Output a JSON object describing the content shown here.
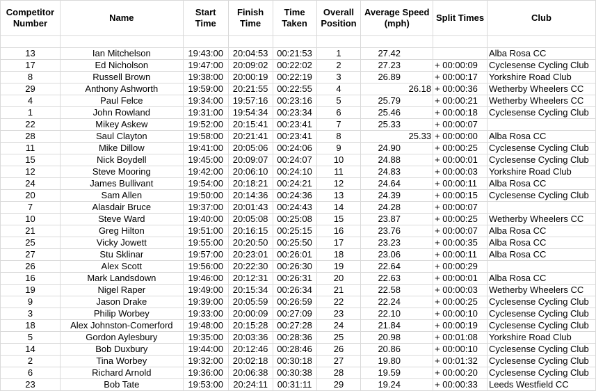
{
  "columns": [
    {
      "key": "number",
      "label": "Competitor Number"
    },
    {
      "key": "name",
      "label": "Name"
    },
    {
      "key": "start",
      "label": "Start Time"
    },
    {
      "key": "finish",
      "label": "Finish Time"
    },
    {
      "key": "taken",
      "label": "Time Taken"
    },
    {
      "key": "position",
      "label": "Overall Position"
    },
    {
      "key": "speed",
      "label": "Average Speed (mph)"
    },
    {
      "key": "split",
      "label": "Split Times"
    },
    {
      "key": "club",
      "label": "Club"
    }
  ],
  "rows": [
    {
      "number": "13",
      "name": "Ian Mitchelson",
      "start": "19:43:00",
      "finish": "20:04:53",
      "taken": "00:21:53",
      "position": "1",
      "speed": "27.42",
      "split": "",
      "club": "Alba Rosa CC",
      "speed_align": "center"
    },
    {
      "number": "17",
      "name": "Ed Nicholson",
      "start": "19:47:00",
      "finish": "20:09:02",
      "taken": "00:22:02",
      "position": "2",
      "speed": "27.23",
      "split": "+ 00:00:09",
      "club": "Cyclesense Cycling Club",
      "speed_align": "center"
    },
    {
      "number": "8",
      "name": "Russell Brown",
      "start": "19:38:00",
      "finish": "20:00:19",
      "taken": "00:22:19",
      "position": "3",
      "speed": "26.89",
      "split": "+ 00:00:17",
      "club": "Yorkshire Road Club",
      "speed_align": "center"
    },
    {
      "number": "29",
      "name": "Anthony Ashworth",
      "start": "19:59:00",
      "finish": "20:21:55",
      "taken": "00:22:55",
      "position": "4",
      "speed": "26.18",
      "split": "+ 00:00:36",
      "club": "Wetherby Wheelers CC",
      "speed_align": "right"
    },
    {
      "number": "4",
      "name": "Paul Felce",
      "start": "19:34:00",
      "finish": "19:57:16",
      "taken": "00:23:16",
      "position": "5",
      "speed": "25.79",
      "split": "+ 00:00:21",
      "club": "Wetherby Wheelers CC",
      "speed_align": "center"
    },
    {
      "number": "1",
      "name": "John Rowland",
      "start": "19:31:00",
      "finish": "19:54:34",
      "taken": "00:23:34",
      "position": "6",
      "speed": "25.46",
      "split": "+ 00:00:18",
      "club": "Cyclesense Cycling Club",
      "speed_align": "center"
    },
    {
      "number": "22",
      "name": "Mikey Askew",
      "start": "19:52:00",
      "finish": "20:15:41",
      "taken": "00:23:41",
      "position": "7",
      "speed": "25.33",
      "split": "+ 00:00:07",
      "club": "",
      "speed_align": "center"
    },
    {
      "number": "28",
      "name": "Saul Clayton",
      "start": "19:58:00",
      "finish": "20:21:41",
      "taken": "00:23:41",
      "position": "8",
      "speed": "25.33",
      "split": "+ 00:00:00",
      "club": "Alba Rosa CC",
      "speed_align": "right"
    },
    {
      "number": "11",
      "name": "Mike Dillow",
      "start": "19:41:00",
      "finish": "20:05:06",
      "taken": "00:24:06",
      "position": "9",
      "speed": "24.90",
      "split": "+ 00:00:25",
      "club": "Cyclesense Cycling Club",
      "speed_align": "center"
    },
    {
      "number": "15",
      "name": "Nick Boydell",
      "start": "19:45:00",
      "finish": "20:09:07",
      "taken": "00:24:07",
      "position": "10",
      "speed": "24.88",
      "split": "+ 00:00:01",
      "club": "Cyclesense Cycling Club",
      "speed_align": "center"
    },
    {
      "number": "12",
      "name": "Steve Mooring",
      "start": "19:42:00",
      "finish": "20:06:10",
      "taken": "00:24:10",
      "position": "11",
      "speed": "24.83",
      "split": "+ 00:00:03",
      "club": "Yorkshire Road Club",
      "speed_align": "center"
    },
    {
      "number": "24",
      "name": "James Bullivant",
      "start": "19:54:00",
      "finish": "20:18:21",
      "taken": "00:24:21",
      "position": "12",
      "speed": "24.64",
      "split": "+ 00:00:11",
      "club": "Alba Rosa CC",
      "speed_align": "center"
    },
    {
      "number": "20",
      "name": "Sam Allen",
      "start": "19:50:00",
      "finish": "20:14:36",
      "taken": "00:24:36",
      "position": "13",
      "speed": "24.39",
      "split": "+ 00:00:15",
      "club": "Cyclesense Cycling Club",
      "speed_align": "center"
    },
    {
      "number": "7",
      "name": "Alasdair Bruce",
      "start": "19:37:00",
      "finish": "20:01:43",
      "taken": "00:24:43",
      "position": "14",
      "speed": "24.28",
      "split": "+ 00:00:07",
      "club": "",
      "speed_align": "center"
    },
    {
      "number": "10",
      "name": "Steve Ward",
      "start": "19:40:00",
      "finish": "20:05:08",
      "taken": "00:25:08",
      "position": "15",
      "speed": "23.87",
      "split": "+ 00:00:25",
      "club": "Wetherby Wheelers CC",
      "speed_align": "center"
    },
    {
      "number": "21",
      "name": "Greg Hilton",
      "start": "19:51:00",
      "finish": "20:16:15",
      "taken": "00:25:15",
      "position": "16",
      "speed": "23.76",
      "split": "+ 00:00:07",
      "club": "Alba Rosa CC",
      "speed_align": "center"
    },
    {
      "number": "25",
      "name": "Vicky Jowett",
      "start": "19:55:00",
      "finish": "20:20:50",
      "taken": "00:25:50",
      "position": "17",
      "speed": "23.23",
      "split": "+ 00:00:35",
      "club": "Alba Rosa CC",
      "speed_align": "center"
    },
    {
      "number": "27",
      "name": "Stu Sklinar",
      "start": "19:57:00",
      "finish": "20:23:01",
      "taken": "00:26:01",
      "position": "18",
      "speed": "23.06",
      "split": "+ 00:00:11",
      "club": "Alba Rosa CC",
      "speed_align": "center"
    },
    {
      "number": "26",
      "name": "Alex Scott",
      "start": "19:56:00",
      "finish": "20:22:30",
      "taken": "00:26:30",
      "position": "19",
      "speed": "22.64",
      "split": "+ 00:00:29",
      "club": "",
      "speed_align": "center"
    },
    {
      "number": "16",
      "name": "Mark Landsdown",
      "start": "19:46:00",
      "finish": "20:12:31",
      "taken": "00:26:31",
      "position": "20",
      "speed": "22.63",
      "split": "+ 00:00:01",
      "club": "Alba Rosa CC",
      "speed_align": "center"
    },
    {
      "number": "19",
      "name": "Nigel Raper",
      "start": "19:49:00",
      "finish": "20:15:34",
      "taken": "00:26:34",
      "position": "21",
      "speed": "22.58",
      "split": "+ 00:00:03",
      "club": "Wetherby Wheelers CC",
      "speed_align": "center"
    },
    {
      "number": "9",
      "name": "Jason Drake",
      "start": "19:39:00",
      "finish": "20:05:59",
      "taken": "00:26:59",
      "position": "22",
      "speed": "22.24",
      "split": "+ 00:00:25",
      "club": "Cyclesense Cycling Club",
      "speed_align": "center"
    },
    {
      "number": "3",
      "name": "Philip Worbey",
      "start": "19:33:00",
      "finish": "20:00:09",
      "taken": "00:27:09",
      "position": "23",
      "speed": "22.10",
      "split": "+ 00:00:10",
      "club": "Cyclesense Cycling Club",
      "speed_align": "center"
    },
    {
      "number": "18",
      "name": "Alex Johnston-Comerford",
      "start": "19:48:00",
      "finish": "20:15:28",
      "taken": "00:27:28",
      "position": "24",
      "speed": "21.84",
      "split": "+ 00:00:19",
      "club": "Cyclesense Cycling Club",
      "speed_align": "center"
    },
    {
      "number": "5",
      "name": "Gordon Aylesbury",
      "start": "19:35:00",
      "finish": "20:03:36",
      "taken": "00:28:36",
      "position": "25",
      "speed": "20.98",
      "split": "+ 00:01:08",
      "club": "Yorkshire Road Club",
      "speed_align": "center"
    },
    {
      "number": "14",
      "name": "Bob Duxbury",
      "start": "19:44:00",
      "finish": "20:12:46",
      "taken": "00:28:46",
      "position": "26",
      "speed": "20.86",
      "split": "+ 00:00:10",
      "club": "Cyclesense Cycling Club",
      "speed_align": "center"
    },
    {
      "number": "2",
      "name": "Tina Worbey",
      "start": "19:32:00",
      "finish": "20:02:18",
      "taken": "00:30:18",
      "position": "27",
      "speed": "19.80",
      "split": "+ 00:01:32",
      "club": "Cyclesense Cycling Club",
      "speed_align": "center"
    },
    {
      "number": "6",
      "name": "Richard Arnold",
      "start": "19:36:00",
      "finish": "20:06:38",
      "taken": "00:30:38",
      "position": "28",
      "speed": "19.59",
      "split": "+ 00:00:20",
      "club": "Cyclesense Cycling Club",
      "speed_align": "center"
    },
    {
      "number": "23",
      "name": "Bob Tate",
      "start": "19:53:00",
      "finish": "20:24:11",
      "taken": "00:31:11",
      "position": "29",
      "speed": "19.24",
      "split": "+ 00:00:33",
      "club": "Leeds Westfield CC",
      "speed_align": "center"
    }
  ]
}
